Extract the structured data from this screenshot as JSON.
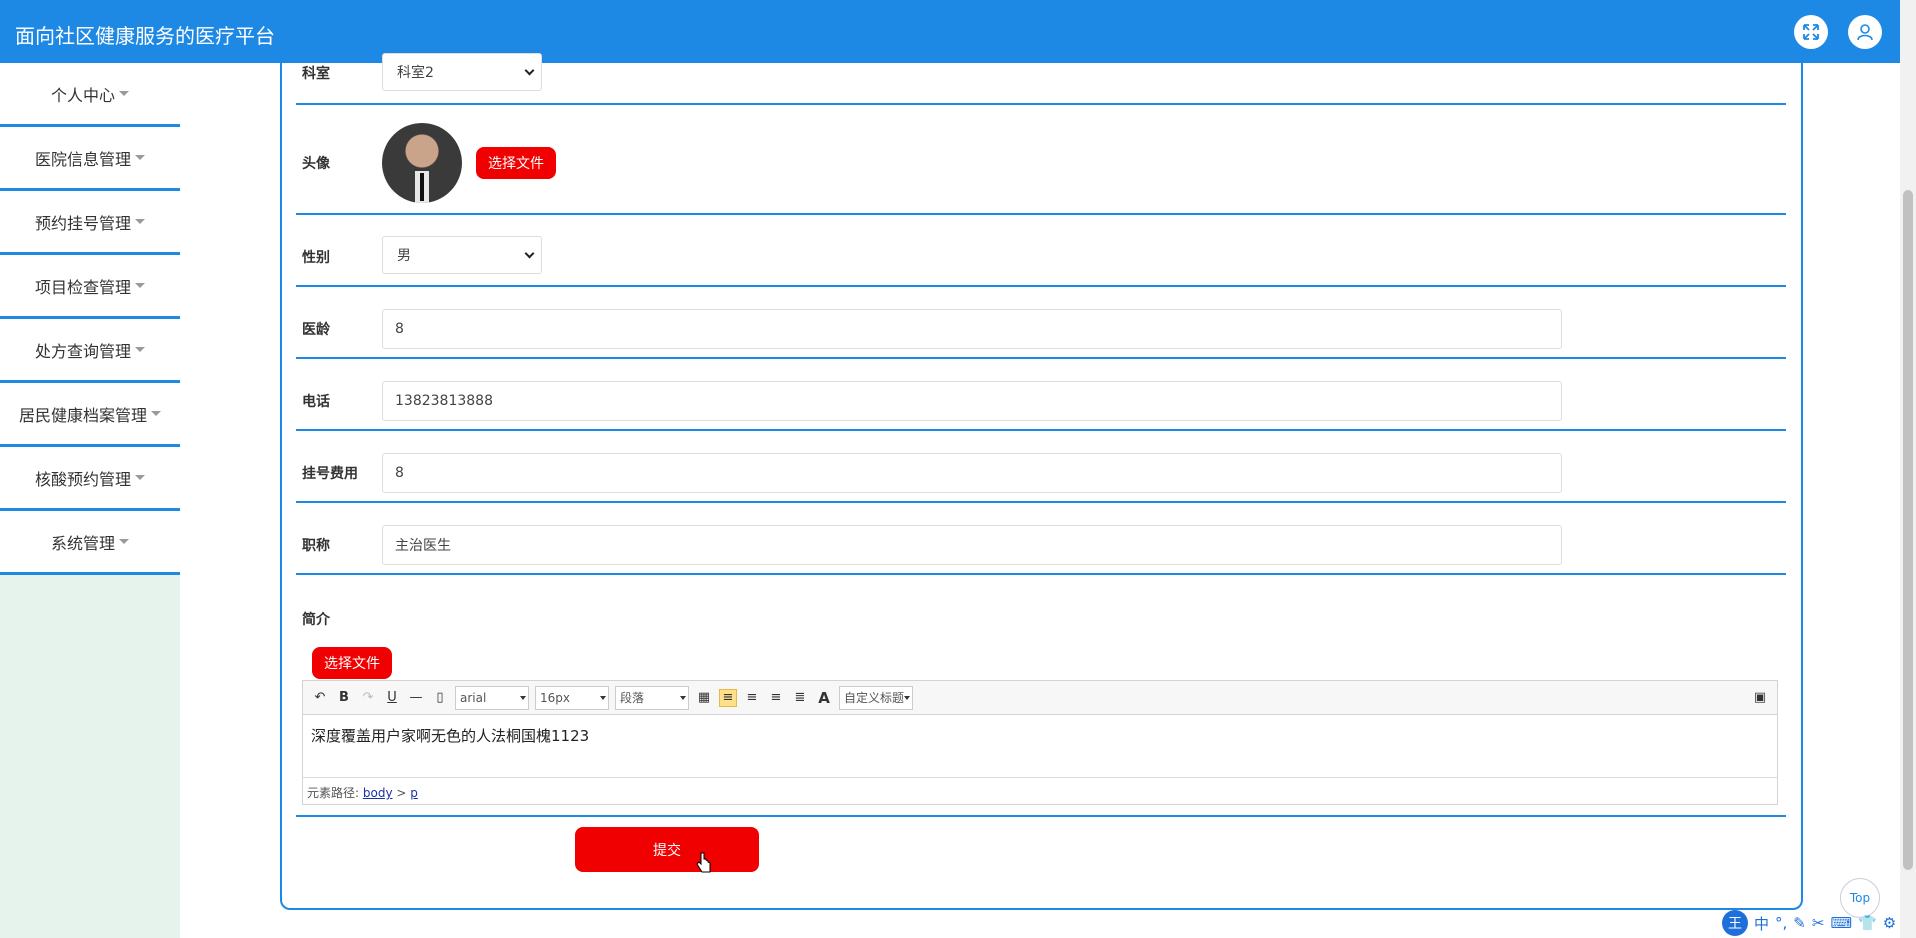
{
  "app": {
    "title": "面向社区健康服务的医疗平台"
  },
  "sidebar": {
    "items": [
      {
        "label": "个人中心"
      },
      {
        "label": "医院信息管理"
      },
      {
        "label": "预约挂号管理"
      },
      {
        "label": "项目检查管理"
      },
      {
        "label": "处方查询管理"
      },
      {
        "label": "居民健康档案管理"
      },
      {
        "label": "核酸预约管理"
      },
      {
        "label": "系统管理"
      }
    ]
  },
  "form": {
    "department": {
      "label": "科室",
      "value": "科室2"
    },
    "avatar": {
      "label": "头像",
      "button": "选择文件"
    },
    "gender": {
      "label": "性别",
      "value": "男"
    },
    "experience": {
      "label": "医龄",
      "value": "8"
    },
    "phone": {
      "label": "电话",
      "value": "13823813888"
    },
    "fee": {
      "label": "挂号费用",
      "value": "8"
    },
    "title": {
      "label": "职称",
      "value": "主治医生"
    },
    "intro": {
      "label": "简介",
      "file_button": "选择文件"
    },
    "submit": "提交"
  },
  "editor": {
    "font_family": "arial",
    "font_size": "16px",
    "paragraph": "段落",
    "custom_title": "自定义标题",
    "content": "深度覆盖用户家啊无色的人法桐国槐1123",
    "path_label": "元素路径:",
    "path_body": "body",
    "path_sep": ">",
    "path_p": "p"
  },
  "misc": {
    "top_label": "Top",
    "ime_logo": "王",
    "ime_lang": "中"
  }
}
